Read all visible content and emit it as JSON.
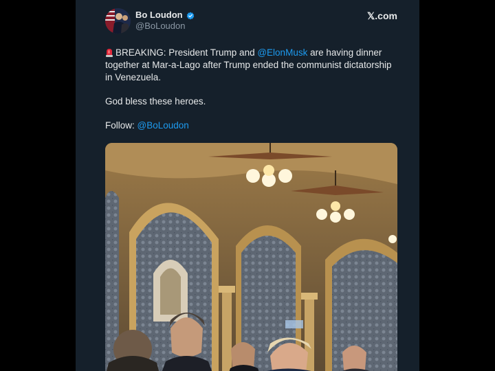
{
  "author": {
    "name": "Bo Loudon",
    "handle": "@BoLoudon"
  },
  "site_label": "𝕏.com",
  "tweet": {
    "line1_prefix": "BREAKING: President Trump and ",
    "line1_mention": "@ElonMusk",
    "line1_suffix": " are having dinner together at Mar-a-Lago after Trump ended the communist dictatorship in Venezuela.",
    "line2": "God bless these heroes.",
    "line3_prefix": "Follow: ",
    "line3_mention": "@BoLoudon"
  },
  "icons": {
    "verified": "verified-badge-icon",
    "siren": "siren-emoji-icon"
  },
  "colors": {
    "background": "#15202b",
    "text": "#e7e9ea",
    "mention": "#1d9bf0",
    "secondary": "#8b98a5"
  }
}
